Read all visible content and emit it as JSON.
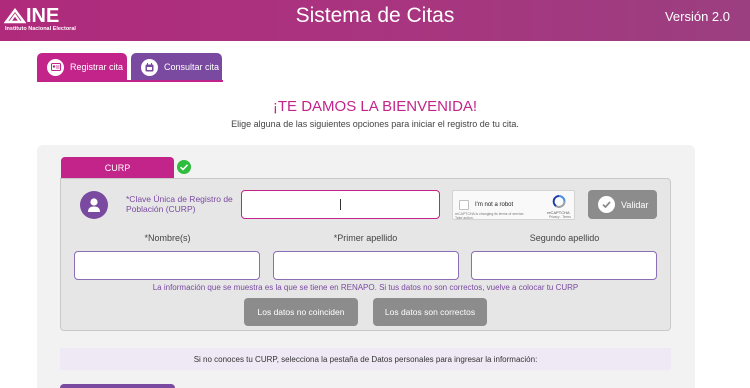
{
  "header": {
    "logo_text": "INE",
    "logo_subtitle": "Instituto Nacional Electoral",
    "title": "Sistema de Citas",
    "version": "Versión 2.0"
  },
  "tabs": [
    {
      "label": "Registrar cita",
      "icon": "id-card-icon",
      "active": true
    },
    {
      "label": "Consultar cita",
      "icon": "calendar-icon",
      "active": false
    }
  ],
  "welcome": {
    "title": "¡TE DAMOS LA BIENVENIDA!",
    "subtitle": "Elige alguna de las siguientes opciones para iniciar el registro de tu cita."
  },
  "form": {
    "curp_tab_label": "CURP",
    "curp_label": "*Clave Única de Registro de Población (CURP)",
    "curp_value": "",
    "recaptcha": {
      "label": "I'm not a robot",
      "brand": "reCAPTCHA",
      "notice": "reCAPTCHA is changing its terms of service. Take action.",
      "terms": "Privacy - Terms"
    },
    "validar_label": "Validar",
    "fields": [
      {
        "label": "*Nombre(s)",
        "value": ""
      },
      {
        "label": "*Primer apellido",
        "value": ""
      },
      {
        "label": "Segundo apellido",
        "value": ""
      }
    ],
    "info_text": "La información que se muestra es la que se tiene en RENAPO. Si tus datos no son correctos, vuelve a colocar tu CURP",
    "btn_no_coinciden": "Los datos no coinciden",
    "btn_correctos": "Los datos son correctos",
    "note": "Si no conoces tu CURP, selecciona la pestaña de Datos personales para ingresar la información:"
  },
  "colors": {
    "brand_magenta": "#c2248a",
    "brand_purple": "#7a4aa1",
    "success_green": "#2ebd3c",
    "button_gray": "#8c8c8c"
  }
}
